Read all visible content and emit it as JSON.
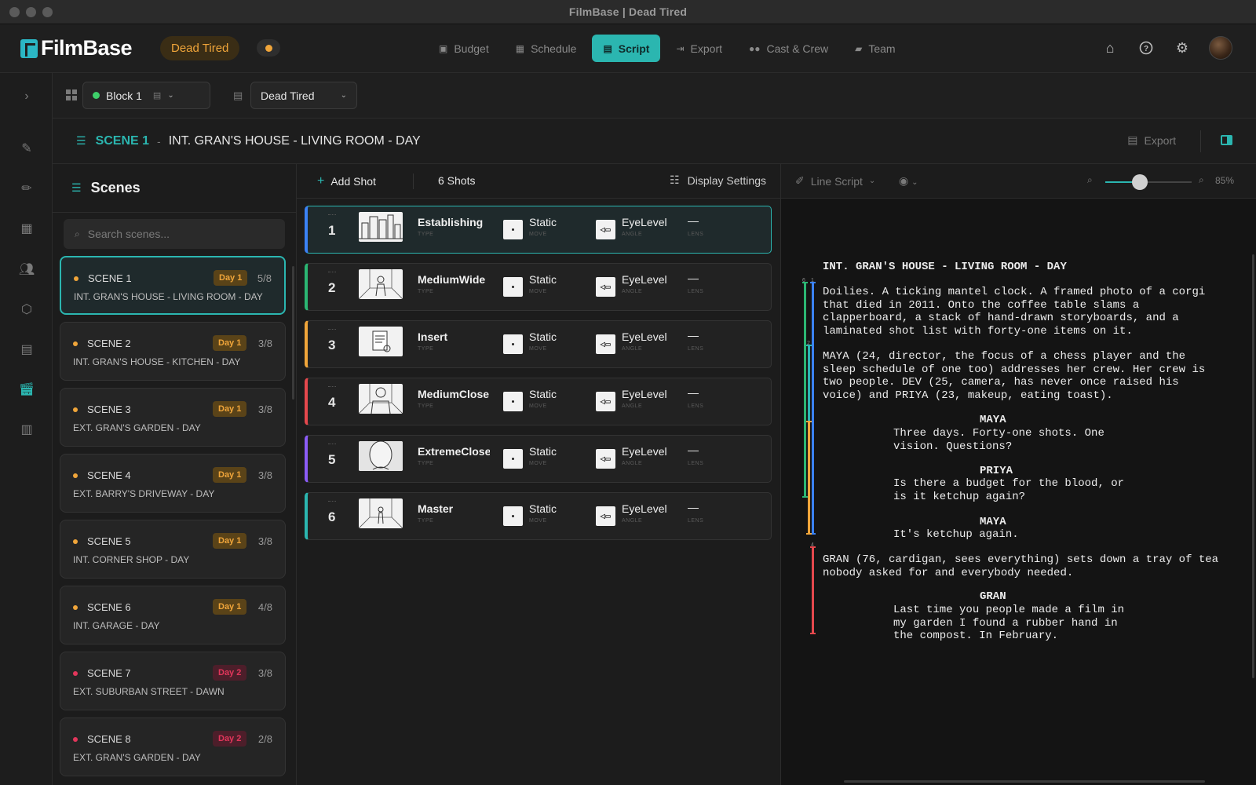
{
  "window": {
    "title": "FilmBase | Dead Tired"
  },
  "app": {
    "logo_text": "FilmBase",
    "project_pill": "Dead Tired",
    "accent": "#2bb6b0"
  },
  "nav": {
    "tabs": [
      {
        "label": "Budget",
        "icon": "wallet-icon"
      },
      {
        "label": "Schedule",
        "icon": "calendar-icon"
      },
      {
        "label": "Script",
        "icon": "script-icon",
        "active": true
      },
      {
        "label": "Export",
        "icon": "export-icon"
      },
      {
        "label": "Cast & Crew",
        "icon": "people-icon"
      },
      {
        "label": "Team",
        "icon": "chat-icon"
      }
    ],
    "right_icons": [
      "home-icon",
      "help-icon",
      "gear-icon",
      "avatar"
    ]
  },
  "toolbar2": {
    "block": "Block 1",
    "script": "Dead Tired"
  },
  "scene_header": {
    "scene_number": "SCENE 1",
    "separator": "-",
    "scene_title": "INT. GRAN'S HOUSE - LIVING ROOM - DAY",
    "export_label": "Export"
  },
  "scenes_panel": {
    "title": "Scenes",
    "search_placeholder": "Search scenes...",
    "scenes": [
      {
        "label": "SCENE 1",
        "day": "Day 1",
        "pages": "5/8",
        "location": "INT. GRAN'S HOUSE - LIVING ROOM - DAY",
        "active": true
      },
      {
        "label": "SCENE 2",
        "day": "Day 1",
        "pages": "3/8",
        "location": "INT. GRAN'S HOUSE - KITCHEN - DAY"
      },
      {
        "label": "SCENE 3",
        "day": "Day 1",
        "pages": "3/8",
        "location": "EXT. GRAN'S GARDEN - DAY"
      },
      {
        "label": "SCENE 4",
        "day": "Day 1",
        "pages": "3/8",
        "location": "EXT. BARRY'S DRIVEWAY - DAY"
      },
      {
        "label": "SCENE 5",
        "day": "Day 1",
        "pages": "3/8",
        "location": "INT. CORNER SHOP - DAY"
      },
      {
        "label": "SCENE 6",
        "day": "Day 1",
        "pages": "4/8",
        "location": "INT. GARAGE - DAY"
      },
      {
        "label": "SCENE 7",
        "day": "Day 2",
        "pages": "3/8",
        "location": "EXT. SUBURBAN STREET - DAWN"
      },
      {
        "label": "SCENE 8",
        "day": "Day 2",
        "pages": "2/8",
        "location": "EXT. GRAN'S GARDEN - DAY"
      }
    ]
  },
  "shots_panel": {
    "add_label": "Add Shot",
    "count_label": "6 Shots",
    "display_settings_label": "Display Settings",
    "captions": {
      "type": "TYPE",
      "move": "MOVE",
      "angle": "ANGLE",
      "lens": "LENS"
    },
    "shots": [
      {
        "number": "1",
        "type": "Establishing",
        "move": "Static",
        "angle": "EyeLevel",
        "lens": "—",
        "color": "#3b82f6",
        "active": true
      },
      {
        "number": "2",
        "type": "MediumWide",
        "move": "Static",
        "angle": "EyeLevel",
        "lens": "—",
        "color": "#2bb673"
      },
      {
        "number": "3",
        "type": "Insert",
        "move": "Static",
        "angle": "EyeLevel",
        "lens": "—",
        "color": "#f0a53a"
      },
      {
        "number": "4",
        "type": "MediumClose",
        "move": "Static",
        "angle": "EyeLevel",
        "lens": "—",
        "color": "#e5484d"
      },
      {
        "number": "5",
        "type": "ExtremeClose",
        "move": "Static",
        "angle": "EyeLevel",
        "lens": "—",
        "color": "#8b5cf6"
      },
      {
        "number": "6",
        "type": "Master",
        "move": "Static",
        "angle": "EyeLevel",
        "lens": "—",
        "color": "#2bb6b0"
      }
    ]
  },
  "script_panel": {
    "mode_label": "Line Script",
    "zoom_label": "85%",
    "zoom_level": 0.4,
    "slugline": "INT. GRAN'S HOUSE - LIVING ROOM - DAY",
    "action_1": "Doilies. A ticking mantel clock. A framed photo of a corgi\nthat died in 2011. Onto the coffee table slams a\nclapperboard, a stack of hand-drawn storyboards, and a\nlaminated shot list with forty-one items on it.",
    "action_2": "MAYA (24, director, the focus of a chess player and the\nsleep schedule of one too) addresses her crew. Her crew is\ntwo people. DEV (25, camera, has never once raised his\nvoice) and PRIYA (23, makeup, eating toast).",
    "char_1": "MAYA",
    "dlg_1": "Three days. Forty-one shots. One\nvision. Questions?",
    "char_2": "PRIYA",
    "dlg_2": "Is there a budget for the blood, or\nis it ketchup again?",
    "char_3": "MAYA",
    "dlg_3": "It's ketchup again.",
    "action_3": "GRAN (76, cardigan, sees everything) sets down a tray of tea\nnobody asked for and everybody needed.",
    "char_4": "GRAN",
    "dlg_4": "Last time you people made a film in\nmy garden I found a rubber hand in\nthe compost. In February.",
    "bracket_labels": [
      "6",
      "1",
      "2",
      "4"
    ]
  }
}
